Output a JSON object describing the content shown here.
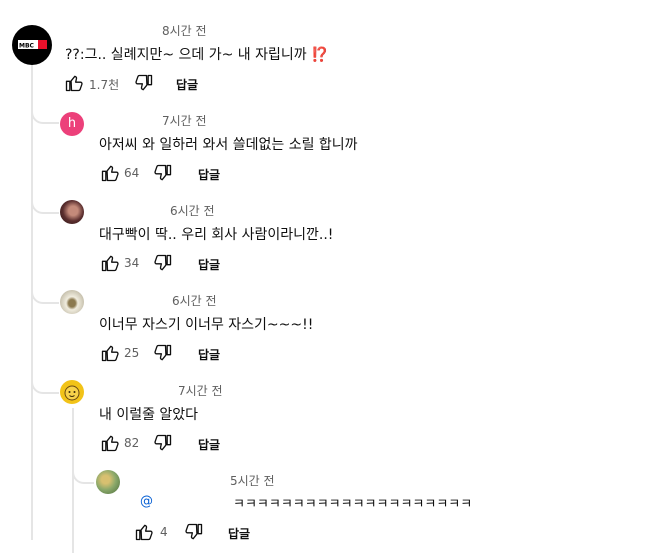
{
  "comments": [
    {
      "time": "8시간 전",
      "text": "??:그.. 실례지만~ 으데 가~ 내 자립니까",
      "emoji": "⁉️",
      "likes": "1.7천",
      "reply_label": "답글",
      "avatar": {
        "logo_text": "MBC",
        "bg": "#000000",
        "accent": "#e8102a"
      }
    }
  ],
  "replies": [
    {
      "time": "7시간 전",
      "text": "아저씨 와 일하러 와서 쓸데없는 소릴 합니까",
      "likes": "64",
      "reply_label": "답글",
      "avatar": {
        "letter": "h",
        "bg": "#ec407a"
      }
    },
    {
      "time": "6시간 전",
      "text": "대구빡이 딱.. 우리 회사 사람이라니깐..!",
      "likes": "34",
      "reply_label": "답글",
      "avatar": {
        "bg": "#5a2e2e"
      }
    },
    {
      "time": "6시간 전",
      "text": "이너무 자스기 이너무 자스기~~~!!",
      "likes": "25",
      "reply_label": "답글",
      "avatar": {
        "bg": "#d9d4c4"
      }
    },
    {
      "time": "7시간 전",
      "text": "내 이럴줄 알았다",
      "likes": "82",
      "reply_label": "답글",
      "avatar": {
        "bg": "#f2c318"
      }
    }
  ],
  "nested_reply": {
    "time": "5시간 전",
    "mention": "@",
    "text": "ㅋㅋㅋㅋㅋㅋㅋㅋㅋㅋㅋㅋㅋㅋㅋㅋㅋㅋㅋㅋ",
    "likes": "4",
    "reply_label": "답글",
    "avatar": {
      "bg": "#8aa86a"
    }
  },
  "colors": {
    "text": "#0f0f0f",
    "secondary": "#606060",
    "thread": "#e5e5e5",
    "link": "#065fd4"
  }
}
